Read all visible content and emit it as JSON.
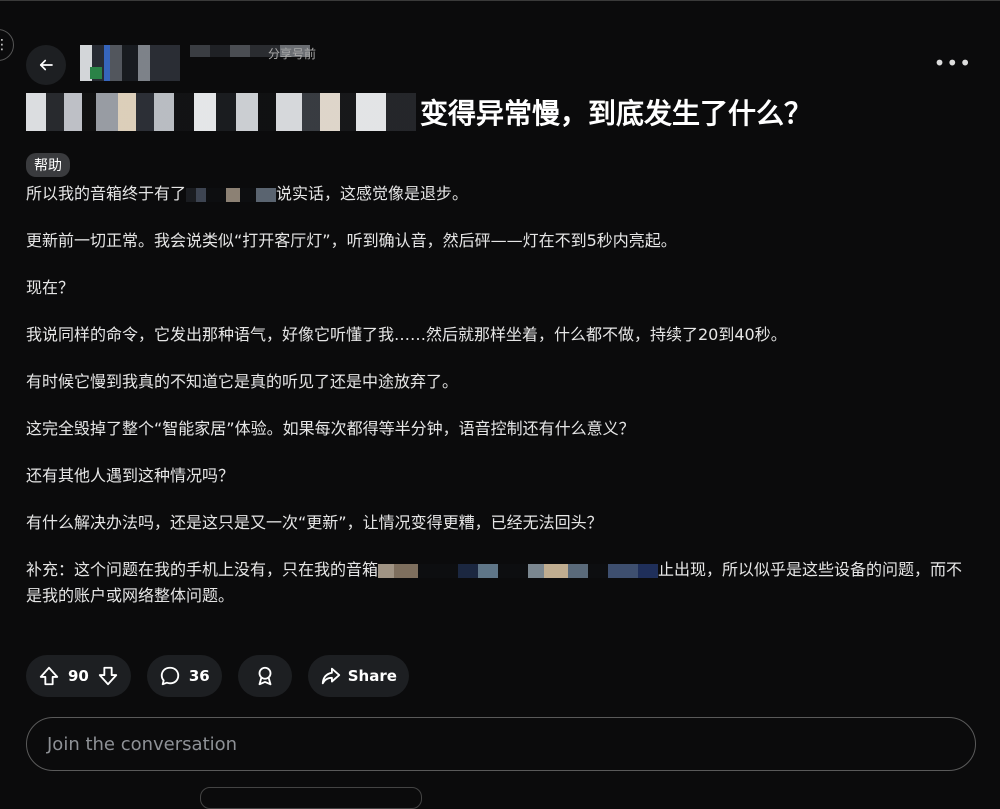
{
  "header": {
    "meta_suffix": "分享号前",
    "more_label": "•••"
  },
  "post": {
    "title": "变得异常慢，到底发生了什么？",
    "flair": "帮助",
    "paragraphs": [
      {
        "before": "所以我的音箱终于有了",
        "after": "说实话，这感觉像是退步。"
      },
      "更新前一切正常。我会说类似“打开客厅灯”，听到确认音，然后砰——灯在不到5秒内亮起。",
      "现在？",
      "我说同样的命令，它发出那种语气，好像它听懂了我……然后就那样坐着，什么都不做，持续了20到40秒。",
      "有时候它慢到我真的不知道它是真的听见了还是中途放弃了。",
      "这完全毁掉了整个“智能家居”体验。如果每次都得等半分钟，语音控制还有什么意义？",
      "还有其他人遇到这种情况吗？",
      "有什么解决办法吗，还是这只是又一次“更新”，让情况变得更糟，已经无法回头？",
      {
        "before": "补充：这个问题在我的手机上没有，只在我的音箱",
        "after": "止出现，所以似乎是这些设备的问题，而不是我的账户或网络整体问题。"
      }
    ]
  },
  "actions": {
    "votes": "90",
    "comments": "36",
    "share_label": "Share"
  },
  "composer": {
    "placeholder": "Join the conversation"
  },
  "icons": {
    "back": "arrow-left-icon",
    "upvote": "arrow-up-icon",
    "downvote": "arrow-down-icon",
    "comment": "speech-bubble-icon",
    "award": "award-icon",
    "share": "share-arrow-icon",
    "more": "ellipsis-icon"
  },
  "colors": {
    "background": "#0b0b0c",
    "pill": "#1d1f22",
    "flair": "#3a3b3e"
  }
}
